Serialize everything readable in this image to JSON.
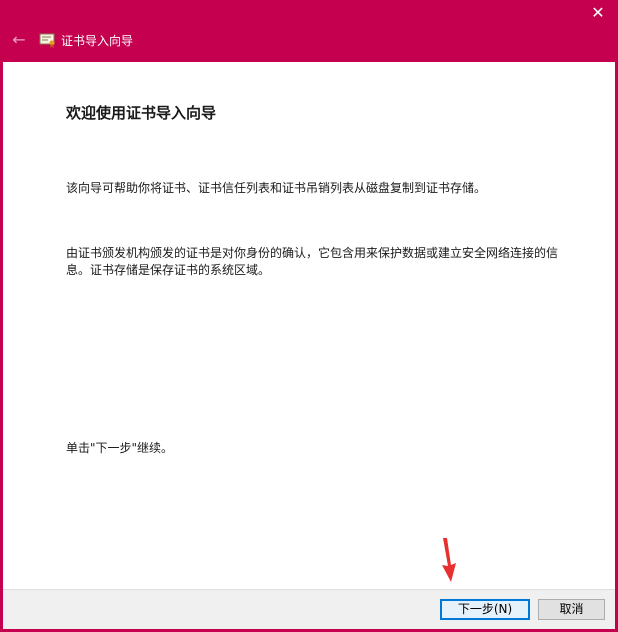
{
  "window": {
    "title": "证书导入向导",
    "close_glyph": "✕",
    "back_glyph": "←"
  },
  "content": {
    "heading": "欢迎使用证书导入向导",
    "paragraph1": "该向导可帮助你将证书、证书信任列表和证书吊销列表从磁盘复制到证书存储。",
    "paragraph2": "由证书颁发机构颁发的证书是对你身份的确认，它包含用来保护数据或建立安全网络连接的信息。证书存储是保存证书的系统区域。",
    "paragraph3": "单击\"下一步\"继续。"
  },
  "footer": {
    "next_label": "下一步(N)",
    "cancel_label": "取消"
  },
  "colors": {
    "accent": "#c4004f",
    "annotation_arrow": "#e8312f",
    "default_button_border": "#0078d7"
  },
  "icons": {
    "title": "certificate-icon",
    "back": "back-arrow-icon",
    "close": "close-icon"
  }
}
